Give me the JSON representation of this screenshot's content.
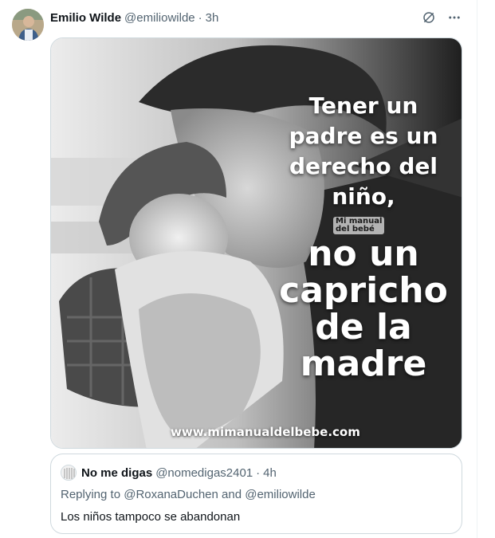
{
  "tweet": {
    "author_name": "Emilio Wilde",
    "author_handle": "@emiliowilde",
    "separator": "·",
    "time": "3h",
    "icons": {
      "grok": "slash-circle-icon",
      "more": "more-horizontal-icon"
    },
    "image": {
      "text_top": "Tener un\npadre es un\nderecho del\nniño,",
      "text_bottom": "no un\ncapricho\nde la\nmadre",
      "logo_text": "Mi manual\ndel bebé",
      "watermark_url": "www.mimanualdelbebe.com"
    }
  },
  "quote": {
    "author_name": "No me digas",
    "author_handle": "@nomedigas2401",
    "separator": "·",
    "time": "4h",
    "replying_prefix": "Replying to ",
    "mention_1": "@RoxanaDuchen",
    "and": " and ",
    "mention_2": "@emiliowilde",
    "text": "Los niños tampoco se abandonan"
  },
  "colors": {
    "text_primary": "#0f1419",
    "text_secondary": "#536471",
    "border": "#cfd9de"
  }
}
